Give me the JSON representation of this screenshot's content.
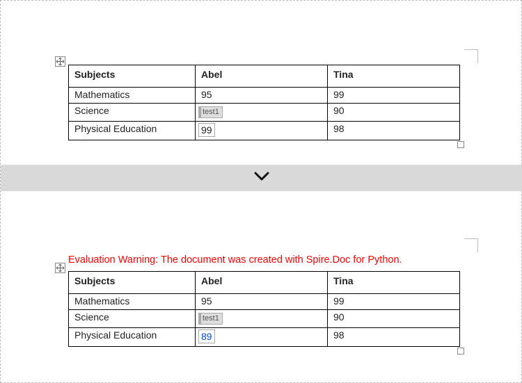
{
  "warning_text": "Evaluation Warning: The document was created with Spire.Doc for Python.",
  "perm_tag_label": "test1",
  "table_top": {
    "headers": [
      "Subjects",
      "Abel",
      "Tina"
    ],
    "rows": [
      {
        "subject": "Mathematics",
        "abel": "95",
        "tina": "99"
      },
      {
        "subject": "Science",
        "abel": "",
        "tina": "90"
      },
      {
        "subject": "Physical Education",
        "abel": "99",
        "tina": "98"
      }
    ]
  },
  "table_bottom": {
    "headers": [
      "Subjects",
      "Abel",
      "Tina"
    ],
    "rows": [
      {
        "subject": "Mathematics",
        "abel": "95",
        "tina": "99"
      },
      {
        "subject": "Science",
        "abel": "",
        "tina": "90"
      },
      {
        "subject": "Physical Education",
        "abel": "89",
        "tina": "98"
      }
    ]
  }
}
